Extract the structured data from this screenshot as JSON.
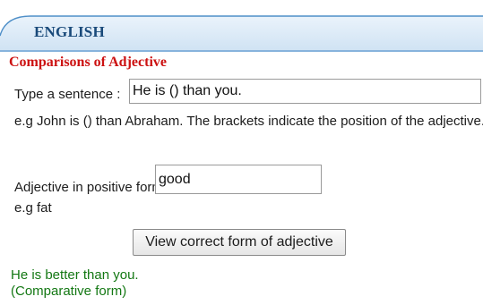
{
  "header": {
    "title": "ENGLISH"
  },
  "section": {
    "title": "Comparisons of Adjective"
  },
  "sentence": {
    "label": "Type a sentence :",
    "value": "He is () than you.",
    "hint": "e.g John is () than Abraham. The brackets indicate the position of the adjective."
  },
  "adjective": {
    "label": "Adjective in positive form:",
    "value": "good",
    "hint": "e.g fat"
  },
  "action": {
    "button_label": "View correct form of adjective"
  },
  "result": {
    "sentence": "He is better than you.",
    "form": "(Comparative form)"
  },
  "colors": {
    "header_fill": "#dcebf7",
    "header_border": "#4f8fc8",
    "header_text": "#1a4a7a",
    "section_title": "#cc1111",
    "result_text": "#147814"
  }
}
